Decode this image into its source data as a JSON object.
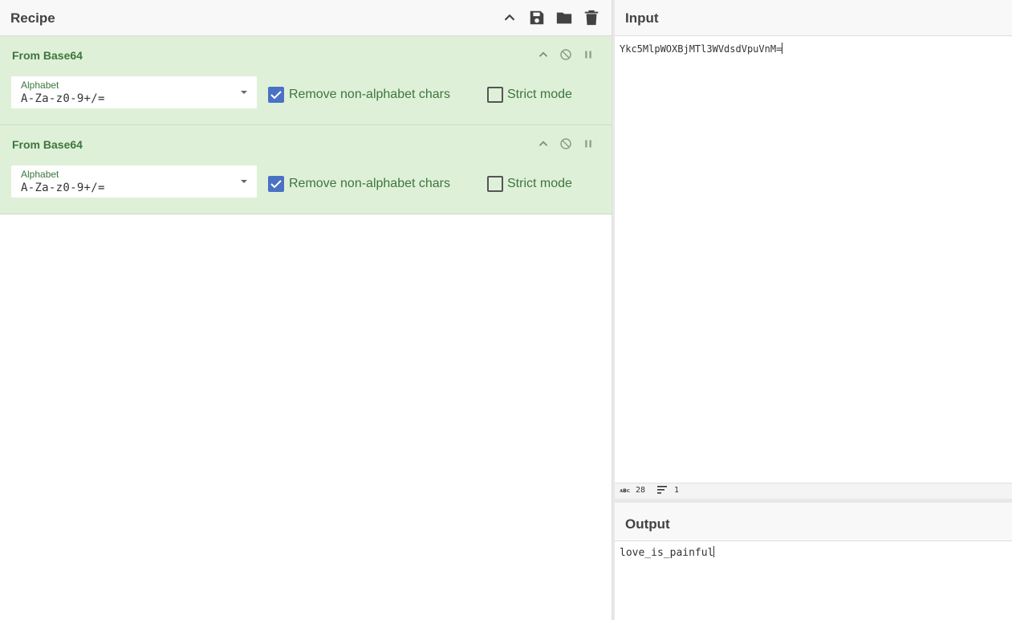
{
  "recipe": {
    "title": "Recipe",
    "header_icons": [
      "chevron-up-icon",
      "save-icon",
      "folder-icon",
      "trash-icon"
    ],
    "operations": [
      {
        "title": "From Base64",
        "alphabet_label": "Alphabet",
        "alphabet_value": "A-Za-z0-9+/=",
        "remove_label": "Remove non-alphabet chars",
        "remove_checked": true,
        "strict_label": "Strict mode",
        "strict_checked": false
      },
      {
        "title": "From Base64",
        "alphabet_label": "Alphabet",
        "alphabet_value": "A-Za-z0-9+/=",
        "remove_label": "Remove non-alphabet chars",
        "remove_checked": true,
        "strict_label": "Strict mode",
        "strict_checked": false
      }
    ]
  },
  "input": {
    "title": "Input",
    "value": "Ykc5MlpWOXBjMTl3WVdsdVpuVnM=",
    "status": {
      "abc_label": "ᴀʙᴄ",
      "length": "28",
      "lines": "1"
    }
  },
  "output": {
    "title": "Output",
    "value": "love_is_painful"
  },
  "colors": {
    "operation_bg": "#dff0d8",
    "operation_text": "#3c763d",
    "checkbox_checked": "#4a72c4",
    "header_bg": "#f8f8f8"
  }
}
